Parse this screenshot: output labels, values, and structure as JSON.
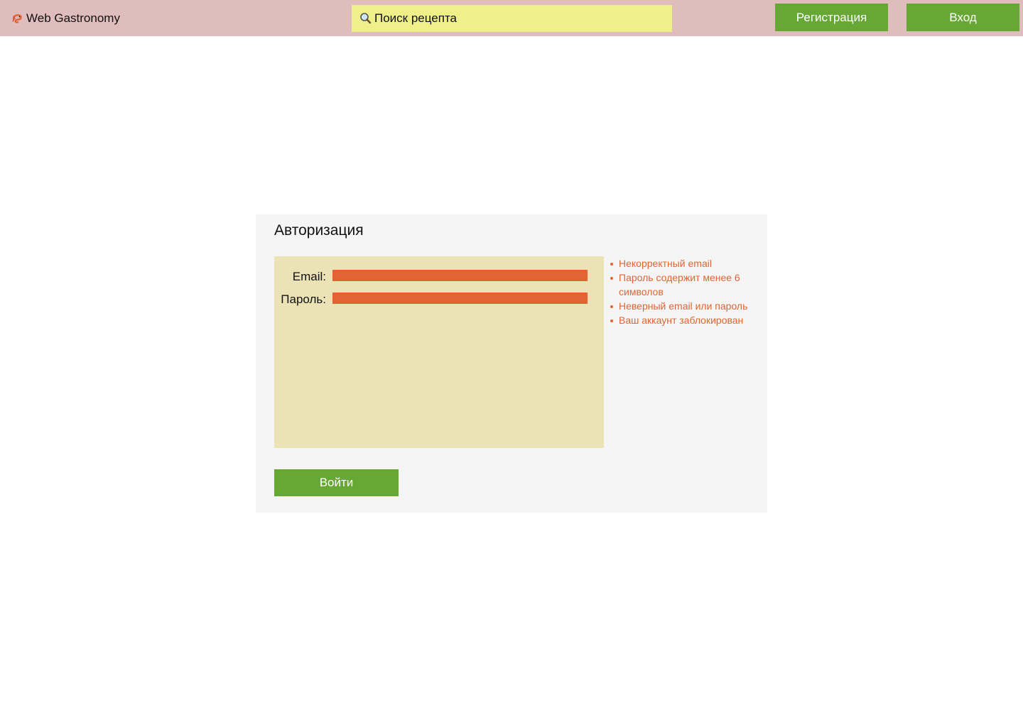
{
  "header": {
    "brand_name": "Web Gastronomy",
    "brand_icon": "shrimp-icon",
    "search": {
      "icon": "magnifier-icon",
      "placeholder": "Поиск рецепта"
    },
    "register_label": "Регистрация",
    "login_label": "Вход"
  },
  "auth": {
    "title": "Авторизация",
    "email_label": "Email:",
    "email_value": "",
    "password_label": "Пароль:",
    "password_value": "",
    "errors": [
      "Некорректный email",
      "Пароль содержит менее 6 символов",
      "Неверный email или пароль",
      "Ваш аккаунт заблокирован"
    ],
    "submit_label": "Войти"
  },
  "colors": {
    "header_bg": "#e0bdbd",
    "search_bg": "#f0f08a",
    "button_green": "#66a833",
    "error_orange": "#e06533",
    "form_panel_bg": "#ebe3b6",
    "card_bg": "#f5f5f5"
  }
}
